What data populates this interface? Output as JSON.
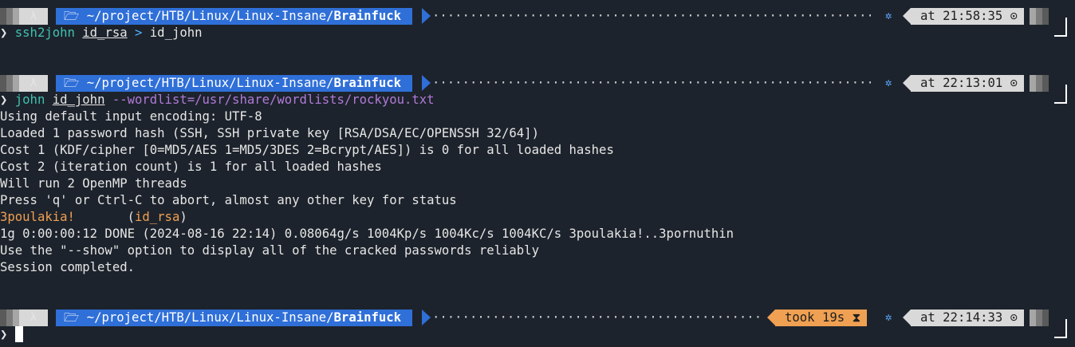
{
  "prompts": [
    {
      "lambda": "λ",
      "path_prefix": "🗁 ~/project/HTB/Linux/Linux-Insane/",
      "path_bold": "Brainfuck",
      "time": "at 21:58:35 ⊙"
    },
    {
      "lambda": "λ",
      "path_prefix": "🗁 ~/project/HTB/Linux/Linux-Insane/",
      "path_bold": "Brainfuck",
      "time": "at 22:13:01 ⊙"
    },
    {
      "lambda": "λ",
      "path_prefix": "🗁 ~/project/HTB/Linux/Linux-Insane/",
      "path_bold": "Brainfuck",
      "took": "took 19s ⧗",
      "time": "at 22:14:33 ⊙"
    }
  ],
  "cmd1": {
    "chevron": "❯",
    "cmd": "ssh2john",
    "arg": "id_rsa",
    "redirect": ">",
    "target": "id_john"
  },
  "cmd2": {
    "chevron": "❯",
    "cmd": "john",
    "arg": "id_john",
    "opt": "--wordlist=/usr/share/wordlists/rockyou.txt"
  },
  "output": [
    "Using default input encoding: UTF-8",
    "Loaded 1 password hash (SSH, SSH private key [RSA/DSA/EC/OPENSSH 32/64])",
    "Cost 1 (KDF/cipher [0=MD5/AES 1=MD5/3DES 2=Bcrypt/AES]) is 0 for all loaded hashes",
    "Cost 2 (iteration count) is 1 for all loaded hashes",
    "Will run 2 OpenMP threads",
    "Press 'q' or Ctrl-C to abort, almost any other key for status"
  ],
  "cracked": {
    "password": "3poulakia!",
    "spacer": "       ",
    "open": "(",
    "file": "id_rsa",
    "close": ")"
  },
  "output2": [
    "1g 0:00:00:12 DONE (2024-08-16 22:14) 0.08064g/s 1004Kp/s 1004Kc/s 1004KC/s 3poulakia!..3pornuthin",
    "Use the \"--show\" option to display all of the cracked passwords reliably",
    "Session completed."
  ],
  "cmd3": {
    "chevron": "❯"
  },
  "colors": {
    "bg": "#1d232c",
    "path_bg": "#2f6fd8",
    "time_bg": "#d9d9d9",
    "took_bg": "#f0a052",
    "gear": "#5aa9ff",
    "cmd": "#3fc1b0",
    "option": "#b07ad8"
  },
  "icons": {
    "gear": "gear-icon",
    "clock": "clock-icon",
    "hourglass": "hourglass-icon",
    "folder": "folder-icon"
  }
}
